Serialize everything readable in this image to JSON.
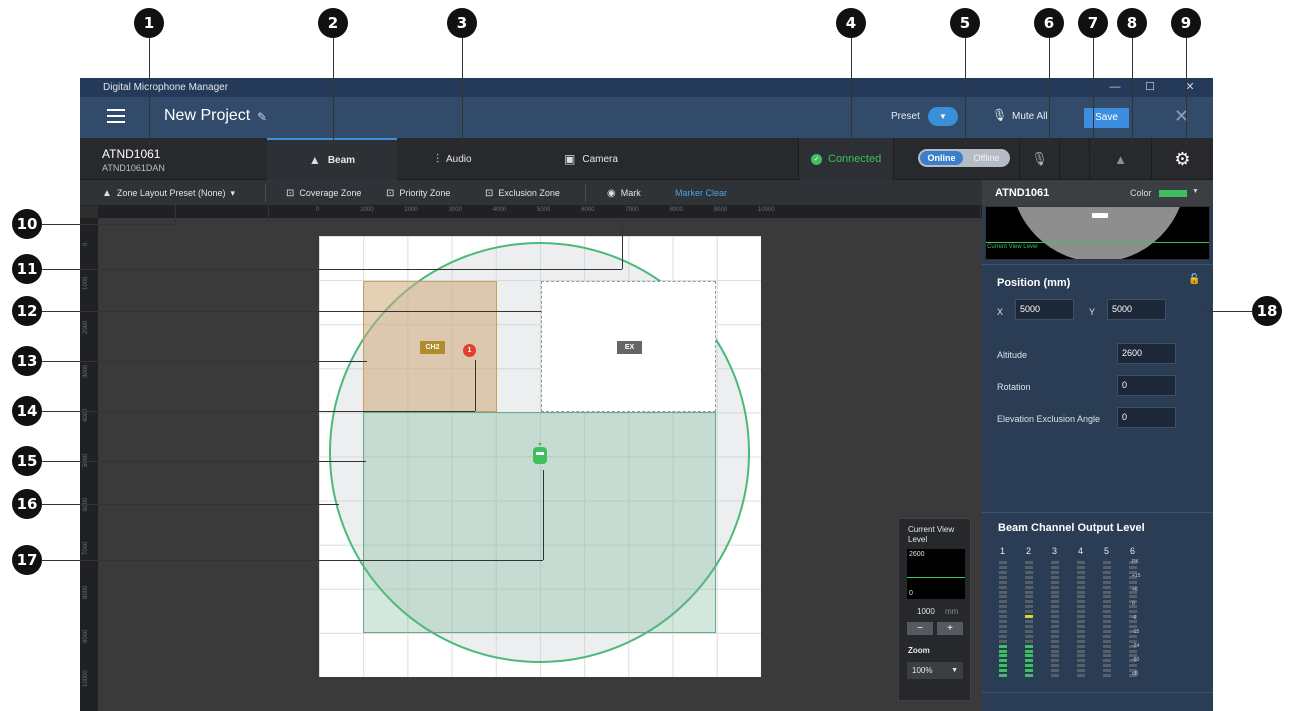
{
  "callouts": [
    "1",
    "2",
    "3",
    "4",
    "5",
    "6",
    "7",
    "8",
    "9",
    "10",
    "11",
    "12",
    "13",
    "14",
    "15",
    "16",
    "17",
    "18"
  ],
  "window": {
    "title": "Digital Microphone Manager",
    "minimize": "—",
    "maximize": "☐",
    "close": "✕"
  },
  "menubar": {
    "project_title": "New Project",
    "preset_label": "Preset",
    "mute_label": "Mute All",
    "save_label": "Save"
  },
  "device": {
    "name": "ATND1061",
    "sub": "ATND1061DAN"
  },
  "tabs": [
    {
      "label": "Beam",
      "icon": "beam-icon"
    },
    {
      "label": "Audio",
      "icon": "sliders-icon"
    },
    {
      "label": "Camera",
      "icon": "camera-icon"
    }
  ],
  "status": {
    "connected": "Connected",
    "online": "Online",
    "offline": "Offline"
  },
  "toolbar": {
    "layout_preset": "Zone Layout Preset (None)",
    "coverage": "Coverage Zone",
    "priority": "Priority Zone",
    "exclusion": "Exclusion Zone",
    "mark": "Mark",
    "marker_clear": "Marker Clear"
  },
  "ruler_top": [
    "0",
    "1000",
    "2000",
    "3000",
    "4000",
    "5000",
    "6000",
    "7000",
    "8000",
    "9000",
    "10000"
  ],
  "ruler_left": [
    "0",
    "1000",
    "2000",
    "3000",
    "4000",
    "5000",
    "6000",
    "7000",
    "8000",
    "9000",
    "10000"
  ],
  "zones": {
    "priority_badge": "CH2",
    "exclusion_badge": "EX",
    "marker_number": "1"
  },
  "view_panel": {
    "label": "Current View Level",
    "top": "2600",
    "bottom": "0",
    "step": "1000",
    "unit": "mm",
    "minus": "−",
    "plus": "+",
    "zoom_label": "Zoom",
    "zoom_value": "100%"
  },
  "right_panel": {
    "title": "ATND1061",
    "color_label": "Color",
    "color": "#3fbf5f",
    "preview_label": "Current View Level",
    "position_header": "Position (mm)",
    "x_label": "X",
    "x_value": "5000",
    "y_label": "Y",
    "y_value": "5000",
    "altitude_label": "Altitude",
    "altitude_value": "2600",
    "rotation_label": "Rotation",
    "rotation_value": "0",
    "elevation_label": "Elevation Exclusion Angle",
    "elevation_value": "0",
    "beam_header": "Beam Channel Output Level",
    "channels": [
      "1",
      "2",
      "3",
      "4",
      "5",
      "6"
    ],
    "channel_levels": [
      0.3,
      0.3,
      0,
      0,
      0,
      0
    ],
    "channel_peaks": [
      null,
      0.52,
      null,
      null,
      null,
      null
    ],
    "scale": [
      "PK",
      "+15",
      "+6",
      "0",
      "-6",
      "-15",
      "-24",
      "-50",
      "dB"
    ]
  }
}
